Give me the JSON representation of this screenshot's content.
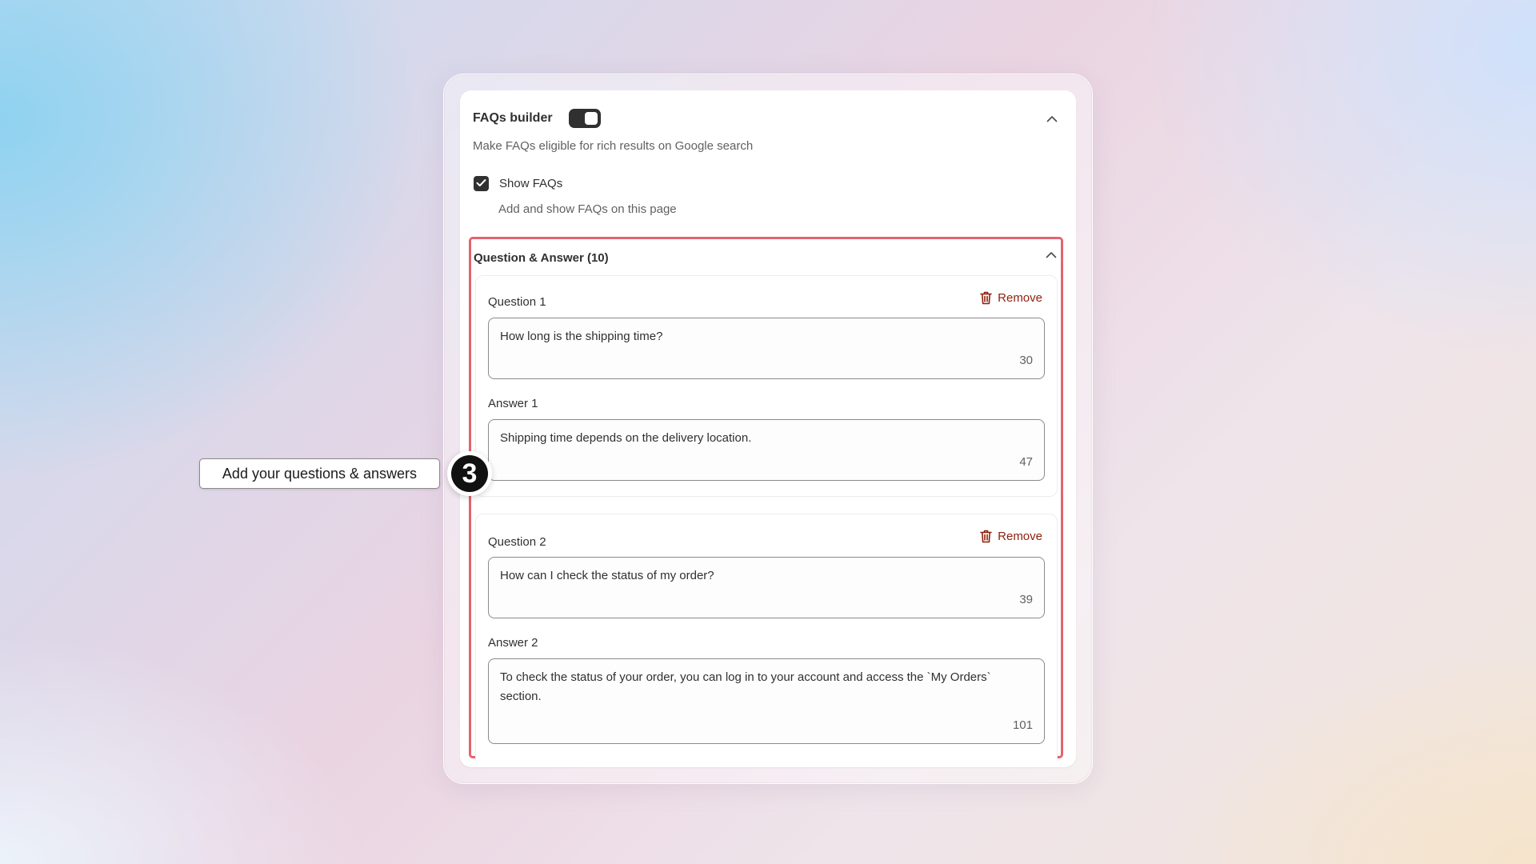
{
  "card": {
    "title": "FAQs builder",
    "toggle_on": true,
    "subtitle": "Make FAQs eligible for rich results on Google search",
    "show_faqs": {
      "checked": true,
      "label": "Show FAQs",
      "help": "Add and show FAQs on this page"
    }
  },
  "qa_section": {
    "title": "Question & Answer (10)",
    "items": [
      {
        "question_label": "Question 1",
        "remove_label": "Remove",
        "question": "How long is the shipping time?",
        "question_count": "30",
        "answer_label": "Answer 1",
        "answer": "Shipping time depends on the delivery location.",
        "answer_count": "47"
      },
      {
        "question_label": "Question 2",
        "remove_label": "Remove",
        "question": "How can I check the status of my order?",
        "question_count": "39",
        "answer_label": "Answer 2",
        "answer": "To check the status of your order, you can log in to your account and access the `My Orders` section.",
        "answer_count": "101"
      }
    ]
  },
  "guide": {
    "tooltip": "Add your questions & answers",
    "step_number": "3"
  },
  "colors": {
    "highlight_border": "#e4646f",
    "remove_text": "#8e1f0b",
    "toggle_bg": "#303030"
  },
  "icons": [
    "chevron-up-icon",
    "checkmark-icon",
    "trash-icon"
  ]
}
